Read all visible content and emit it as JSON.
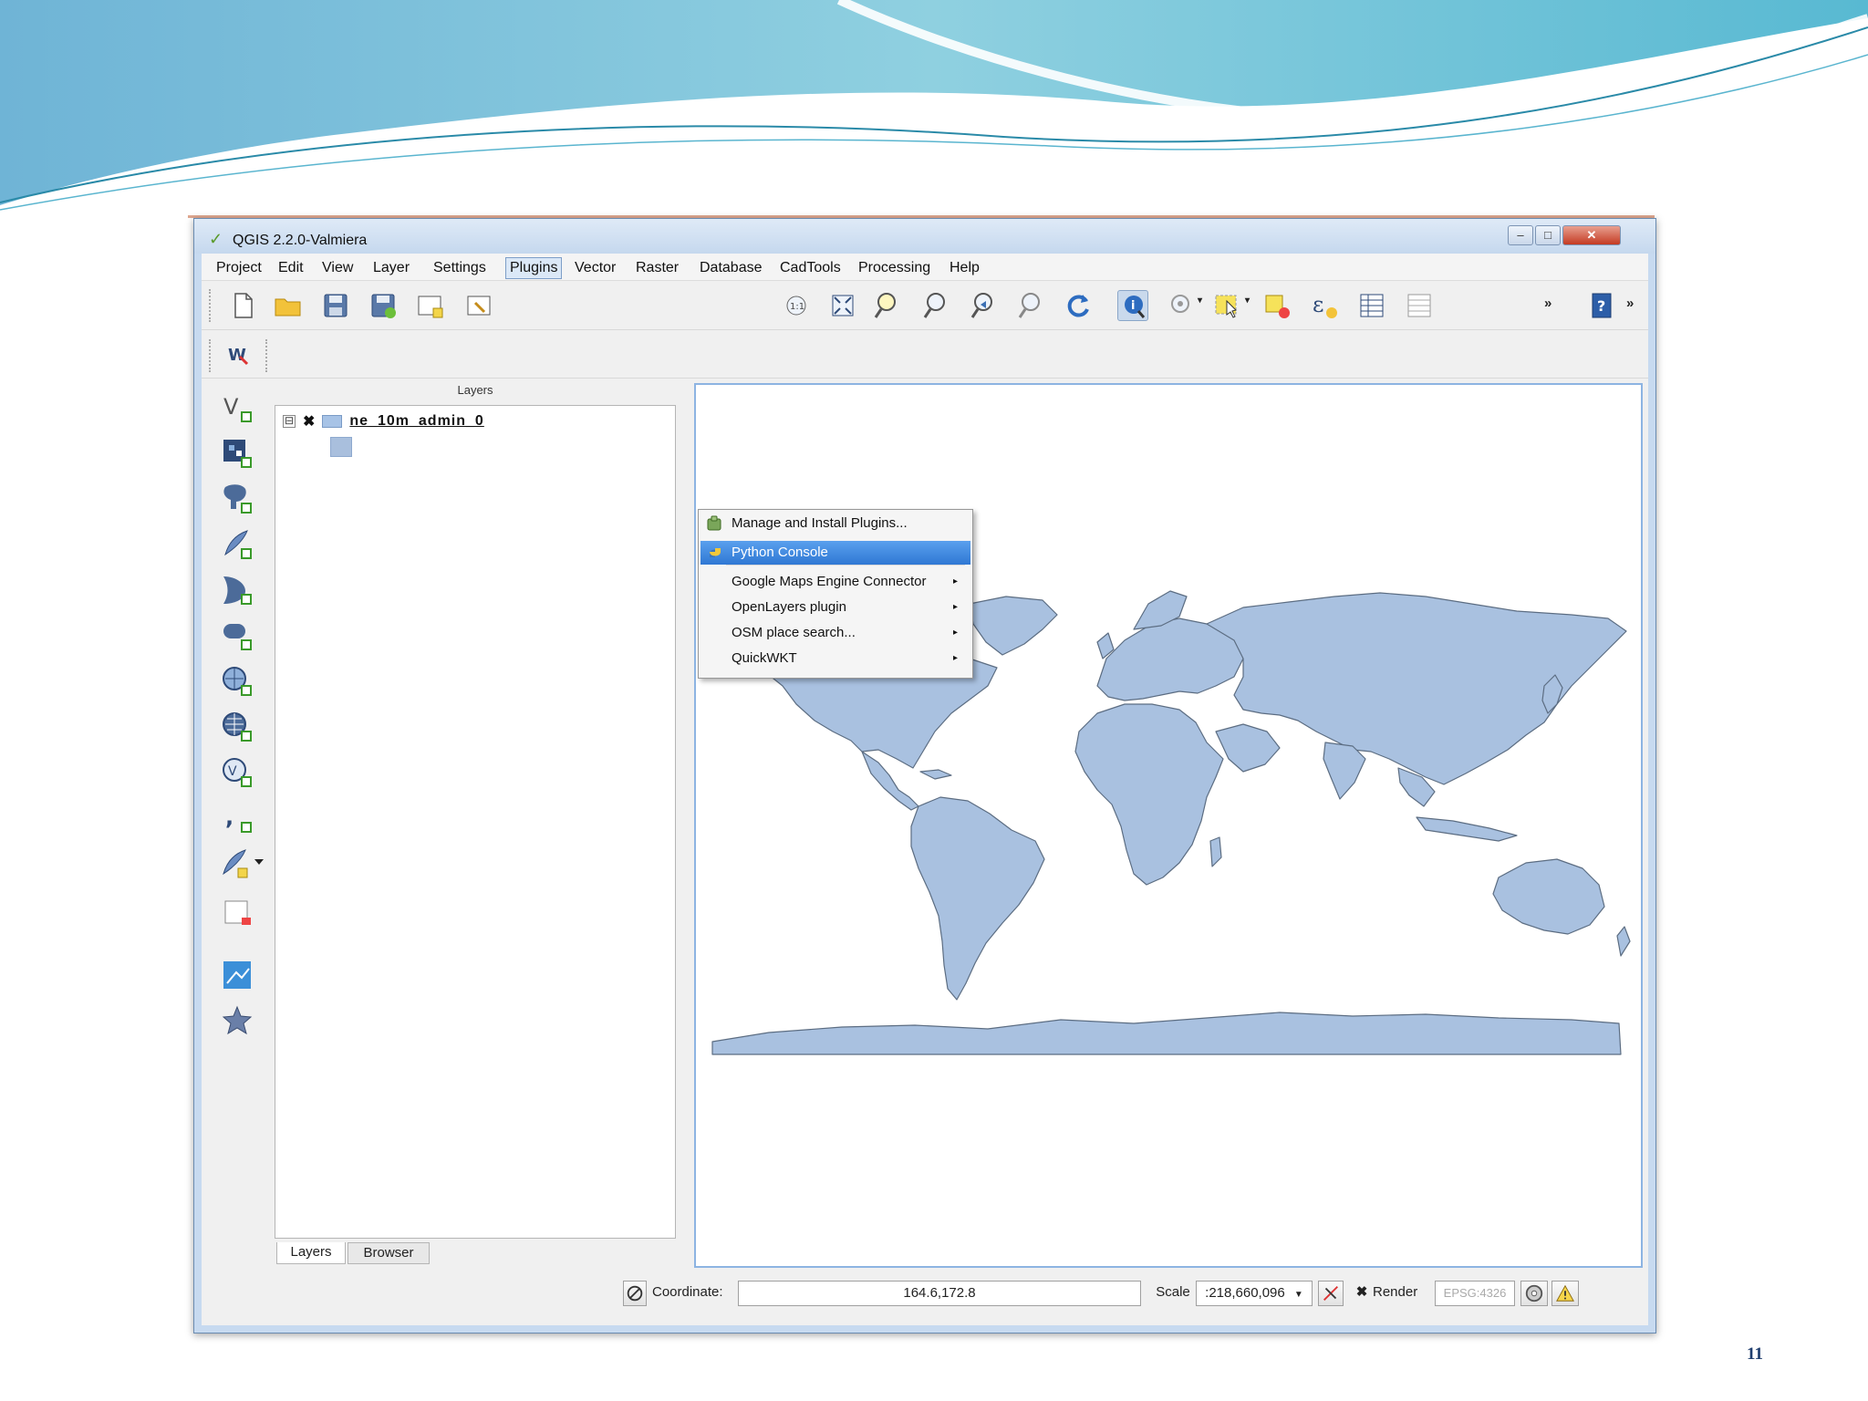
{
  "window": {
    "title": "QGIS 2.2.0-Valmiera",
    "controls": {
      "minimize": "–",
      "maximize": "□",
      "close": "✕"
    }
  },
  "menubar": {
    "items": [
      "Project",
      "Edit",
      "View",
      "Layer",
      "Settings",
      "Plugins",
      "Vector",
      "Raster",
      "Database",
      "CadTools",
      "Processing",
      "Help"
    ],
    "active": "Plugins"
  },
  "plugins_menu": {
    "items": [
      {
        "label": "Manage and Install Plugins...",
        "submenu": false,
        "icon": "plugin-icon"
      },
      {
        "label": "Python Console",
        "submenu": false,
        "icon": "python-icon",
        "highlighted": true
      },
      {
        "label": "Google Maps Engine Connector",
        "submenu": true
      },
      {
        "label": "OpenLayers plugin",
        "submenu": true
      },
      {
        "label": "OSM place search...",
        "submenu": true
      },
      {
        "label": "QuickWKT",
        "submenu": true
      }
    ],
    "submenu_arrow": "▸"
  },
  "toolbar": {
    "overflow_chevron": "»",
    "digitize_label": "W"
  },
  "layers_panel": {
    "title": "Layers",
    "expander": "⊟",
    "check": "✖",
    "layer_name": "ne_10m_admin_0",
    "tabs": [
      "Layers",
      "Browser"
    ],
    "selected_tab": "Layers"
  },
  "statusbar": {
    "coordinate_label": "Coordinate:",
    "coordinate_value": "164.6,172.8",
    "scale_label": "Scale",
    "scale_value": ":218,660,096",
    "render_check": "✖",
    "render_label": "Render",
    "crs": "EPSG:4326"
  },
  "colors": {
    "land_fill": "#a9c1e0",
    "land_stroke": "#5c6d82",
    "menu_highlight": "#3a84dc",
    "window_frame": "#c7daf0"
  },
  "slide": {
    "page_number": "11"
  }
}
